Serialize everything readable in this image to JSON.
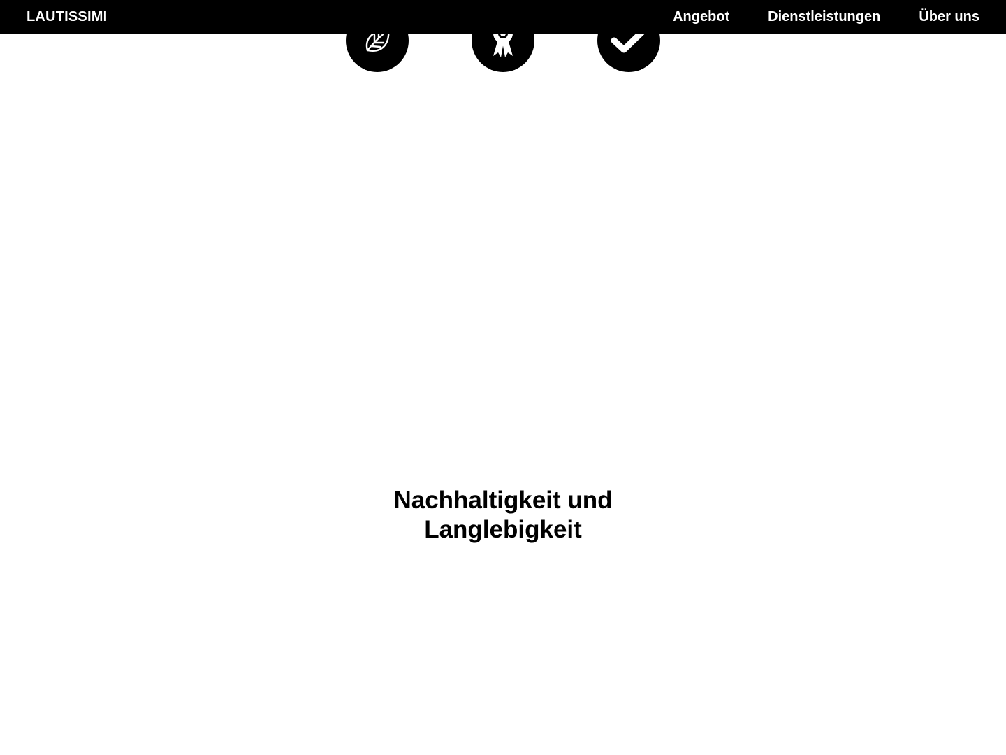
{
  "header": {
    "brand": "LAUTISSIMI",
    "nav": [
      {
        "label": "Angebot"
      },
      {
        "label": "Dienstleistungen"
      },
      {
        "label": "Über uns"
      }
    ]
  },
  "features": {
    "icons": [
      {
        "icon": "leaf-icon"
      },
      {
        "icon": "award-ribbon-icon"
      },
      {
        "icon": "checkmark-icon"
      }
    ],
    "heading_lines": [
      "Nachhaltigkeit und",
      "Langlebigkeit"
    ]
  },
  "colors": {
    "navbar_bg": "#000000",
    "navbar_text": "#ffffff",
    "page_bg": "#ffffff",
    "icon_bg": "#000000",
    "heading": "#000000"
  }
}
